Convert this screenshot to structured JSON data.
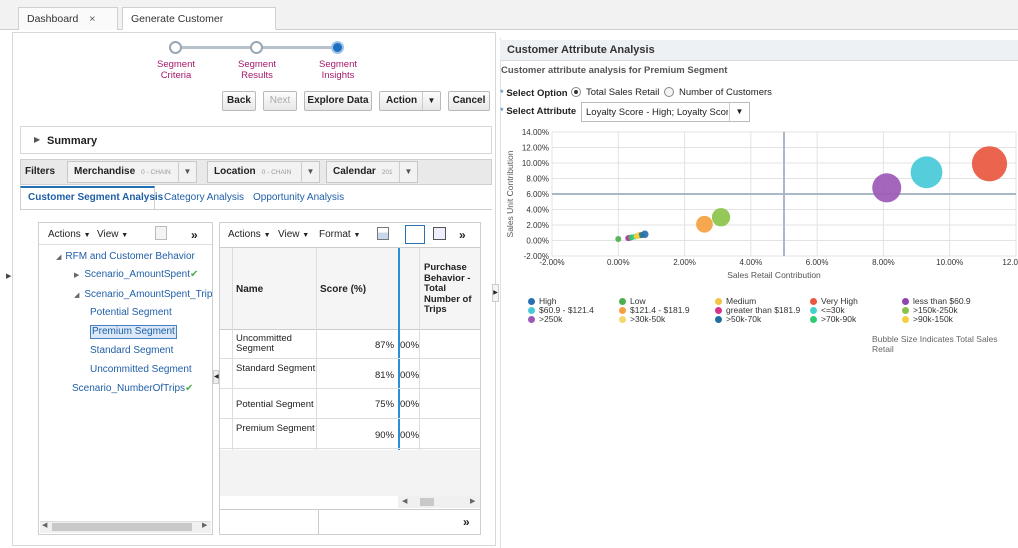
{
  "tabs": [
    {
      "label": "Dashboard",
      "close": "×"
    },
    {
      "label": "Generate Customer Segment",
      "close": "×"
    }
  ],
  "train": {
    "steps": [
      {
        "line1": "Segment",
        "line2": "Criteria"
      },
      {
        "line1": "Segment",
        "line2": "Results"
      },
      {
        "line1": "Segment",
        "line2": "Insights"
      }
    ]
  },
  "toolbar": {
    "back": "Back",
    "next": "Next",
    "explore": "Explore Data",
    "action": "Action",
    "cancel": "Cancel"
  },
  "summary": {
    "title": "Summary"
  },
  "filters": {
    "label": "Filters",
    "chips": [
      {
        "label": "Merchandise",
        "detail": "0 - CHAIN"
      },
      {
        "label": "Location",
        "detail": "0 - CHAIN"
      },
      {
        "label": "Calendar",
        "detail": "201"
      }
    ]
  },
  "subtabs": [
    "Customer Segment Analysis",
    "Category Analysis",
    "Opportunity Analysis"
  ],
  "tree_panel": {
    "actions": "Actions",
    "view": "View",
    "more": "»",
    "items": [
      {
        "label": "RFM and Customer Behavior",
        "check": ""
      },
      {
        "label": "Scenario_AmountSpent",
        "check": "✔"
      },
      {
        "label": "Scenario_AmountSpent_Trips",
        "check": ""
      },
      {
        "label": "Potential Segment",
        "check": ""
      },
      {
        "label": "Premium Segment",
        "check": ""
      },
      {
        "label": "Standard Segment",
        "check": ""
      },
      {
        "label": "Uncommitted Segment",
        "check": ""
      },
      {
        "label": "Scenario_NumberOfTrips",
        "check": "✔"
      }
    ]
  },
  "grid_panel": {
    "actions": "Actions",
    "view": "View",
    "format": "Format",
    "more": "»",
    "headers": [
      "Name",
      "Score (%)",
      "Purchase Behavior - Total Number of Trips"
    ],
    "rows": [
      {
        "name": "Uncommitted Segment",
        "score": "87%",
        "partial": "00%"
      },
      {
        "name": "Standard Segment",
        "score": "81%",
        "partial": "00%"
      },
      {
        "name": "Potential Segment",
        "score": "75%",
        "partial": "00%"
      },
      {
        "name": "Premium Segment",
        "score": "90%",
        "partial": "00%"
      }
    ],
    "footer_more": "»"
  },
  "right": {
    "title": "Customer Attribute Analysis",
    "subtitle": "Customer attribute analysis for Premium Segment",
    "select_option_label": "Select Option",
    "required_mark": "*",
    "option_total": "Total Sales Retail",
    "option_customers": "Number of Customers",
    "select_attribute_label": "Select Attribute",
    "attribute_value": "Loyalty Score - High; Loyalty Score",
    "footnote": "Bubble Size Indicates Total Sales Retail"
  },
  "chart_data": {
    "type": "scatter",
    "xlabel": "Sales Retail Contribution",
    "ylabel": "Sales Unit Contribution",
    "xlim": [
      -2,
      12
    ],
    "ylim": [
      -2,
      14
    ],
    "xticks": [
      "-2.00%",
      "0.00%",
      "2.00%",
      "4.00%",
      "6.00%",
      "8.00%",
      "10.00%",
      "12.00%"
    ],
    "yticks": [
      "-2.00%",
      "0.00%",
      "2.00%",
      "4.00%",
      "6.00%",
      "8.00%",
      "10.00%",
      "12.00%",
      "14.00%"
    ],
    "grid": true,
    "series": [
      {
        "name": "High",
        "color": "#2a6fb0",
        "x": 0.8,
        "y": 0.8,
        "size": 0.5
      },
      {
        "name": "Low",
        "color": "#4caf50",
        "x": 0.0,
        "y": 0.2,
        "size": 0.2
      },
      {
        "name": "Medium",
        "color": "#f5c342",
        "x": 0.65,
        "y": 0.7,
        "size": 0.4
      },
      {
        "name": "Very High",
        "color": "#e8573f",
        "x": 11.2,
        "y": 9.9,
        "size": 11.0
      },
      {
        "name": "less than $60.9",
        "color": "#8e44ad",
        "x": 0.3,
        "y": 0.3,
        "size": 0.3
      },
      {
        "name": "$60.9 - $121.4",
        "color": "#48c9d8",
        "x": 9.3,
        "y": 8.8,
        "size": 9.0
      },
      {
        "name": "$121.4 - $181.9",
        "color": "#f5a142",
        "x": 2.6,
        "y": 2.1,
        "size": 2.5
      },
      {
        "name": "greater than $181.9",
        "color": "#d6338a",
        "x": 0.35,
        "y": 0.35,
        "size": 0.3
      },
      {
        "name": "<=30k",
        "color": "#48d1cc",
        "x": 0.5,
        "y": 0.5,
        "size": 0.3
      },
      {
        "name": ">150k-250k",
        "color": "#8bc34a",
        "x": 3.1,
        "y": 3.0,
        "size": 3.0
      },
      {
        "name": ">250k",
        "color": "#9b59b6",
        "x": 8.1,
        "y": 6.8,
        "size": 7.5
      },
      {
        "name": ">30k-50k",
        "color": "#f5d76e",
        "x": 0.6,
        "y": 0.6,
        "size": 0.3
      },
      {
        "name": ">50k-70k",
        "color": "#1f6fa0",
        "x": 0.7,
        "y": 0.7,
        "size": 0.3
      },
      {
        "name": ">70k-90k",
        "color": "#2ecc71",
        "x": 0.4,
        "y": 0.4,
        "size": 0.2
      },
      {
        "name": ">90k-150k",
        "color": "#f4d03f",
        "x": 0.55,
        "y": 0.55,
        "size": 0.2
      }
    ]
  }
}
